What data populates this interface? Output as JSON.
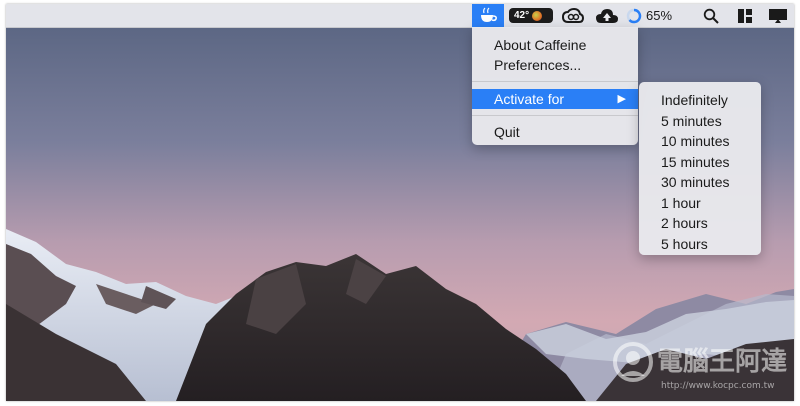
{
  "menubar": {
    "temperature": "42°",
    "battery_percent": "65%",
    "icons": [
      "caffeine-cup-icon",
      "temperature-icon",
      "creative-cloud-icon",
      "cloud-upload-icon",
      "battery-ring-icon",
      "search-icon",
      "window-layout-icon",
      "display-icon"
    ]
  },
  "caffeine_menu": {
    "items": {
      "about": "About Caffeine",
      "preferences": "Preferences...",
      "activate_for": "Activate for",
      "quit": "Quit"
    },
    "submenu_arrow": "▶"
  },
  "activate_submenu": {
    "options": [
      "Indefinitely",
      "5 minutes",
      "10 minutes",
      "15 minutes",
      "30 minutes",
      "1 hour",
      "2 hours",
      "5 hours"
    ]
  },
  "watermark": {
    "brand_chinese": "電腦王阿達",
    "url": "http://www.kocpc.com.tw"
  },
  "colors": {
    "accent": "#2a7ff6",
    "menu_bg": "#e8e8ec",
    "menubar_bg": "#ececf0"
  }
}
